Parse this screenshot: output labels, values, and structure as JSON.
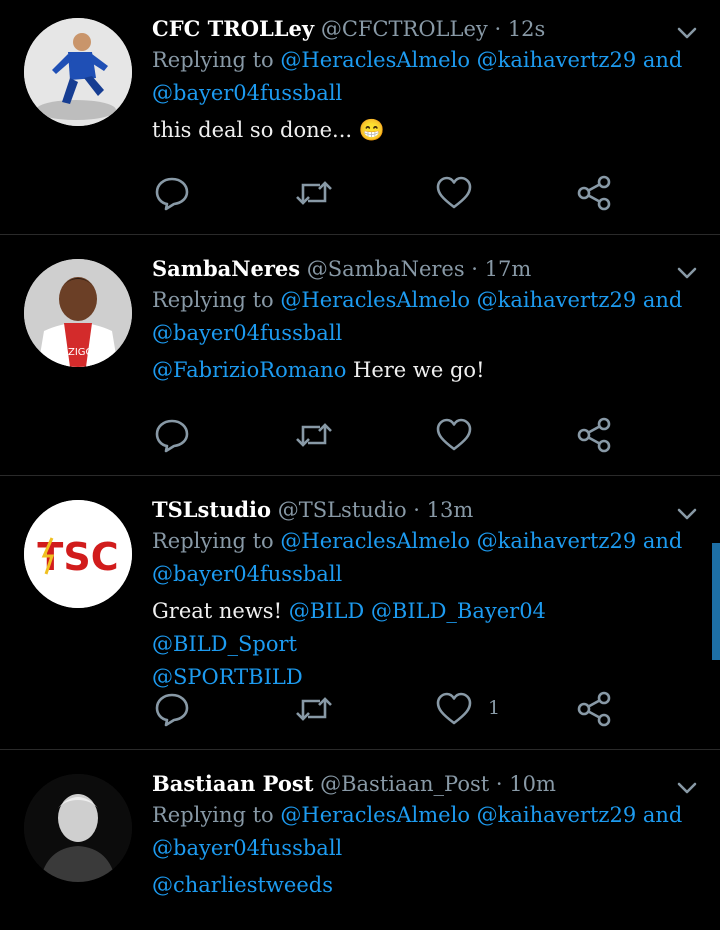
{
  "tweets": [
    {
      "name": "CFC TROLLey",
      "handle": "@CFCTROLLey",
      "time": "12s",
      "replying_prefix": "Replying to",
      "replying_line1": "@HeraclesAlmelo @kaihavertz29 and",
      "replying_line2": "@bayer04fussball",
      "text": "this deal so done...",
      "emoji": "😁",
      "likes": ""
    },
    {
      "name": "SambaNeres",
      "handle": "@SambaNeres",
      "time": "17m",
      "replying_prefix": "Replying to",
      "replying_line1": "@HeraclesAlmelo @kaihavertz29 and",
      "replying_line2": "@bayer04fussball",
      "text_mention": "@FabrizioRomano",
      "text": "Here we go!",
      "likes": ""
    },
    {
      "name": "TSLstudio",
      "handle": "@TSLstudio",
      "time": "13m",
      "replying_prefix": "Replying to",
      "replying_line1": "@HeraclesAlmelo @kaihavertz29 and",
      "replying_line2": "@bayer04fussball",
      "text": "Great news!",
      "text_mentions_line1": "@BILD @BILD_Bayer04 @BILD_Sport",
      "text_mentions_line2": "@SPORTBILD",
      "avatar_logo": "TSC",
      "likes": "1"
    },
    {
      "name": "Bastiaan Post",
      "handle": "@Bastiaan_Post",
      "time": "10m",
      "replying_prefix": "Replying to",
      "replying_line1": "@HeraclesAlmelo @kaihavertz29 and",
      "replying_line2": "@bayer04fussball",
      "text_mention": "@charliestweeds",
      "likes": ""
    }
  ],
  "dot": "·",
  "icons": {
    "reply": "reply-icon",
    "retweet": "retweet-icon",
    "like": "heart-icon",
    "share": "share-icon",
    "menu": "chevron-down-icon"
  },
  "colors": {
    "background": "#000000",
    "mention": "#1d9bf0",
    "muted": "#8899a6",
    "scrollbar": "#1d6fa5"
  }
}
